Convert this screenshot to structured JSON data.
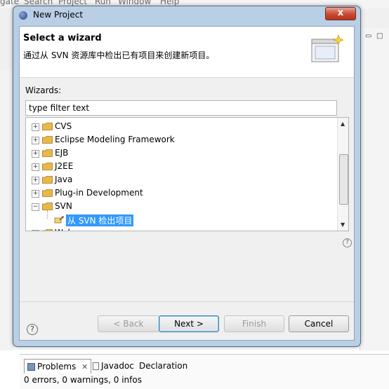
{
  "background": {
    "menu_items": [
      "gate",
      "Search",
      "Project",
      "Run",
      "Window",
      "Help"
    ],
    "bottom_tabs": [
      "Problems",
      "Javadoc",
      "Declaration"
    ],
    "status_text": "0 errors, 0 warnings, 0 infos"
  },
  "dialog": {
    "title": "New Project",
    "close_glyph": "x",
    "banner": {
      "title": "Select a wizard",
      "description": "通过从 SVN 资源库中检出已有项目来创建新项目。"
    },
    "wizards_label": "Wizards:",
    "filter": {
      "value": "type filter text",
      "placeholder": "type filter text"
    },
    "tree": [
      {
        "label": "CVS",
        "expanded": false
      },
      {
        "label": "Eclipse Modeling Framework",
        "expanded": false
      },
      {
        "label": "EJB",
        "expanded": false
      },
      {
        "label": "J2EE",
        "expanded": false
      },
      {
        "label": "Java",
        "expanded": false
      },
      {
        "label": "Plug-in Development",
        "expanded": false
      },
      {
        "label": "SVN",
        "expanded": true
      },
      {
        "label": "从 SVN 检出项目",
        "child": true,
        "selected": true
      },
      {
        "label": "Web",
        "expanded": false
      }
    ],
    "buttons": {
      "back": "< Back",
      "next": "Next >",
      "finish": "Finish",
      "cancel": "Cancel"
    },
    "help_glyph": "?"
  },
  "colors": {
    "selection": "#3399ff",
    "dialog_frame": "#b9cfe6",
    "folder": "#e8b84a"
  }
}
